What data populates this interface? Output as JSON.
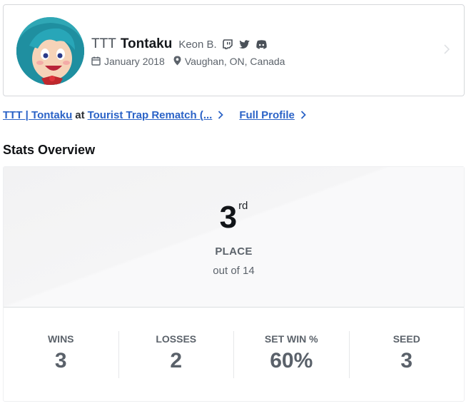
{
  "profile": {
    "prefix": "TTT",
    "gamertag": "Tontaku",
    "real_name": "Keon B.",
    "social_icons": [
      "twitch-icon",
      "twitter-icon",
      "discord-icon"
    ],
    "joined": "January 2018",
    "location": "Vaughan, ON, Canada"
  },
  "links": {
    "player_link": "TTT | Tontaku",
    "at": "at",
    "event_link": "Tourist Trap Rematch (...",
    "full_profile": "Full Profile"
  },
  "section_title": "Stats Overview",
  "placement": {
    "number": "3",
    "suffix": "rd",
    "label": "PLACE",
    "out_of": "out of 14"
  },
  "stats": [
    {
      "label": "WINS",
      "value": "3"
    },
    {
      "label": "LOSSES",
      "value": "2"
    },
    {
      "label": "SET WIN %",
      "value": "60%"
    },
    {
      "label": "SEED",
      "value": "3"
    }
  ],
  "colors": {
    "link": "#2b63c7",
    "text_muted": "#5c636b",
    "avatar_bg": "#2fa7b5"
  }
}
